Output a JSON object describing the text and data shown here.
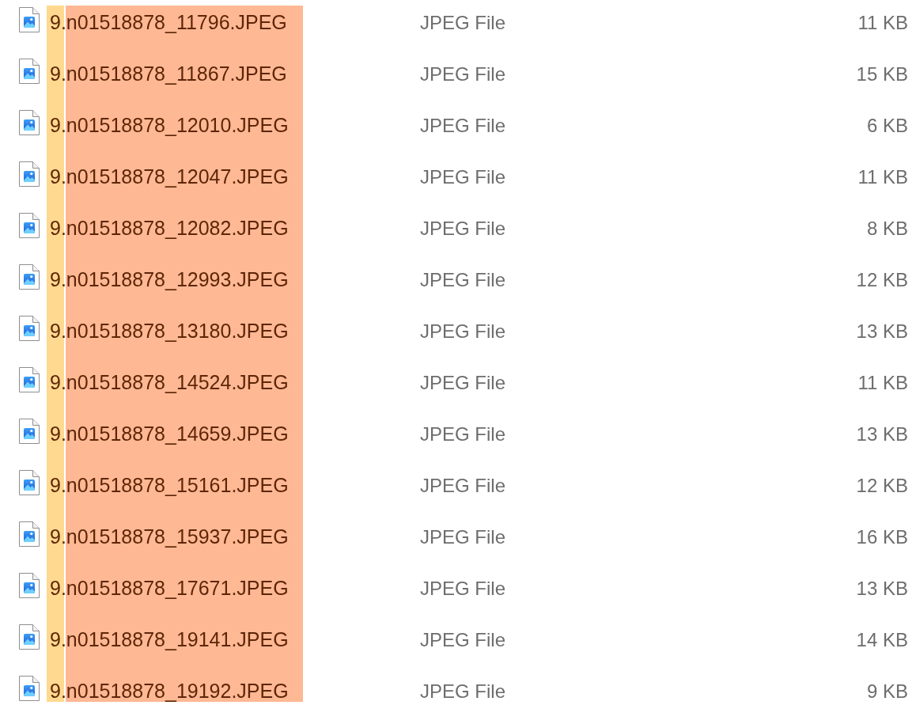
{
  "highlights": [
    {
      "color": "#ffd98f"
    },
    {
      "color": "#ffb894"
    }
  ],
  "files": [
    {
      "name": "9.n01518878_11796.JPEG",
      "type": "JPEG File",
      "size": "11 KB"
    },
    {
      "name": "9.n01518878_11867.JPEG",
      "type": "JPEG File",
      "size": "15 KB"
    },
    {
      "name": "9.n01518878_12010.JPEG",
      "type": "JPEG File",
      "size": "6 KB"
    },
    {
      "name": "9.n01518878_12047.JPEG",
      "type": "JPEG File",
      "size": "11 KB"
    },
    {
      "name": "9.n01518878_12082.JPEG",
      "type": "JPEG File",
      "size": "8 KB"
    },
    {
      "name": "9.n01518878_12993.JPEG",
      "type": "JPEG File",
      "size": "12 KB"
    },
    {
      "name": "9.n01518878_13180.JPEG",
      "type": "JPEG File",
      "size": "13 KB"
    },
    {
      "name": "9.n01518878_14524.JPEG",
      "type": "JPEG File",
      "size": "11 KB"
    },
    {
      "name": "9.n01518878_14659.JPEG",
      "type": "JPEG File",
      "size": "13 KB"
    },
    {
      "name": "9.n01518878_15161.JPEG",
      "type": "JPEG File",
      "size": "12 KB"
    },
    {
      "name": "9.n01518878_15937.JPEG",
      "type": "JPEG File",
      "size": "16 KB"
    },
    {
      "name": "9.n01518878_17671.JPEG",
      "type": "JPEG File",
      "size": "13 KB"
    },
    {
      "name": "9.n01518878_19141.JPEG",
      "type": "JPEG File",
      "size": "14 KB"
    },
    {
      "name": "9.n01518878_19192.JPEG",
      "type": "JPEG File",
      "size": "9 KB"
    }
  ]
}
